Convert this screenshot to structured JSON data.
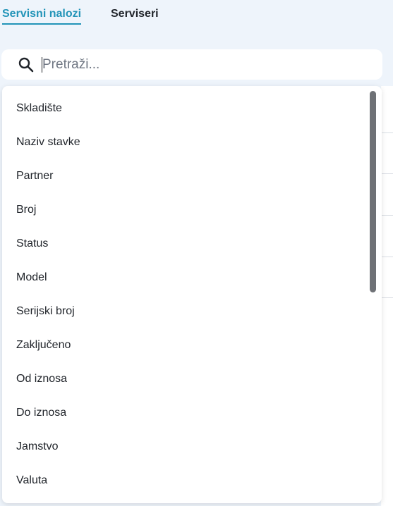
{
  "tabs": {
    "active": "Servisni nalozi",
    "inactive": "Serviseri"
  },
  "search": {
    "placeholder": "Pretraži...",
    "value": ""
  },
  "dropdown": {
    "options": [
      "Skladište",
      "Naziv stavke",
      "Partner",
      "Broj",
      "Status",
      "Model",
      "Serijski broj",
      "Zaključeno",
      "Od iznosa",
      "Do iznosa",
      "Jamstvo",
      "Valuta"
    ]
  },
  "colors": {
    "accent": "#2294b8",
    "background": "#eef4fb",
    "scrollbar": "#6e7176"
  }
}
